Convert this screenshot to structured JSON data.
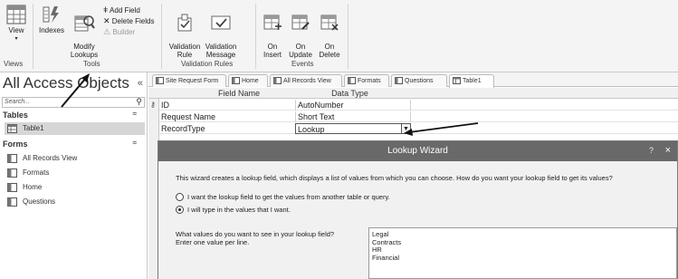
{
  "ribbon": {
    "groups": {
      "views": "Views",
      "tools": "Tools",
      "validation_rules": "Validation Rules",
      "events": "Events"
    },
    "buttons": {
      "view": "View",
      "indexes": "Indexes",
      "modify_lookups": "Modify\nLookups",
      "add_field": "Add Field",
      "delete_fields": "Delete Fields",
      "builder": "Builder",
      "validation_rule": "Validation\nRule",
      "validation_message": "Validation\nMessage",
      "on_insert": "On\nInsert",
      "on_update": "On\nUpdate",
      "on_delete": "On\nDelete"
    }
  },
  "nav": {
    "title": "All Access Objects",
    "collapse": "«",
    "search_placeholder": "Search...",
    "tables_label": "Tables",
    "tables": [
      "Table1"
    ],
    "forms_label": "Forms",
    "forms": [
      "All Records View",
      "Formats",
      "Home",
      "Questions"
    ]
  },
  "tabs": [
    "Site Request Form",
    "Home",
    "All Records View",
    "Formats",
    "Questions",
    "Table1"
  ],
  "grid": {
    "col_field_name": "Field Name",
    "col_data_type": "Data Type",
    "rows": [
      {
        "field": "ID",
        "type": "AutoNumber"
      },
      {
        "field": "Request Name",
        "type": "Short Text"
      },
      {
        "field": "RecordType",
        "type": "Lookup"
      }
    ]
  },
  "wizard": {
    "title": "Lookup Wizard",
    "help": "?",
    "close": "×",
    "intro": "This wizard creates a lookup field, which displays a list of values from which you can choose. How do you want your lookup field to get its values?",
    "option_table": "I want the lookup field to get the values from another table or query.",
    "option_type": "I will type in the values that I want.",
    "prompt_line1": "What values do you want to see in your lookup field?",
    "prompt_line2": "Enter one value per line.",
    "values": [
      "Legal",
      "Contracts",
      "HR",
      "Financial"
    ]
  }
}
